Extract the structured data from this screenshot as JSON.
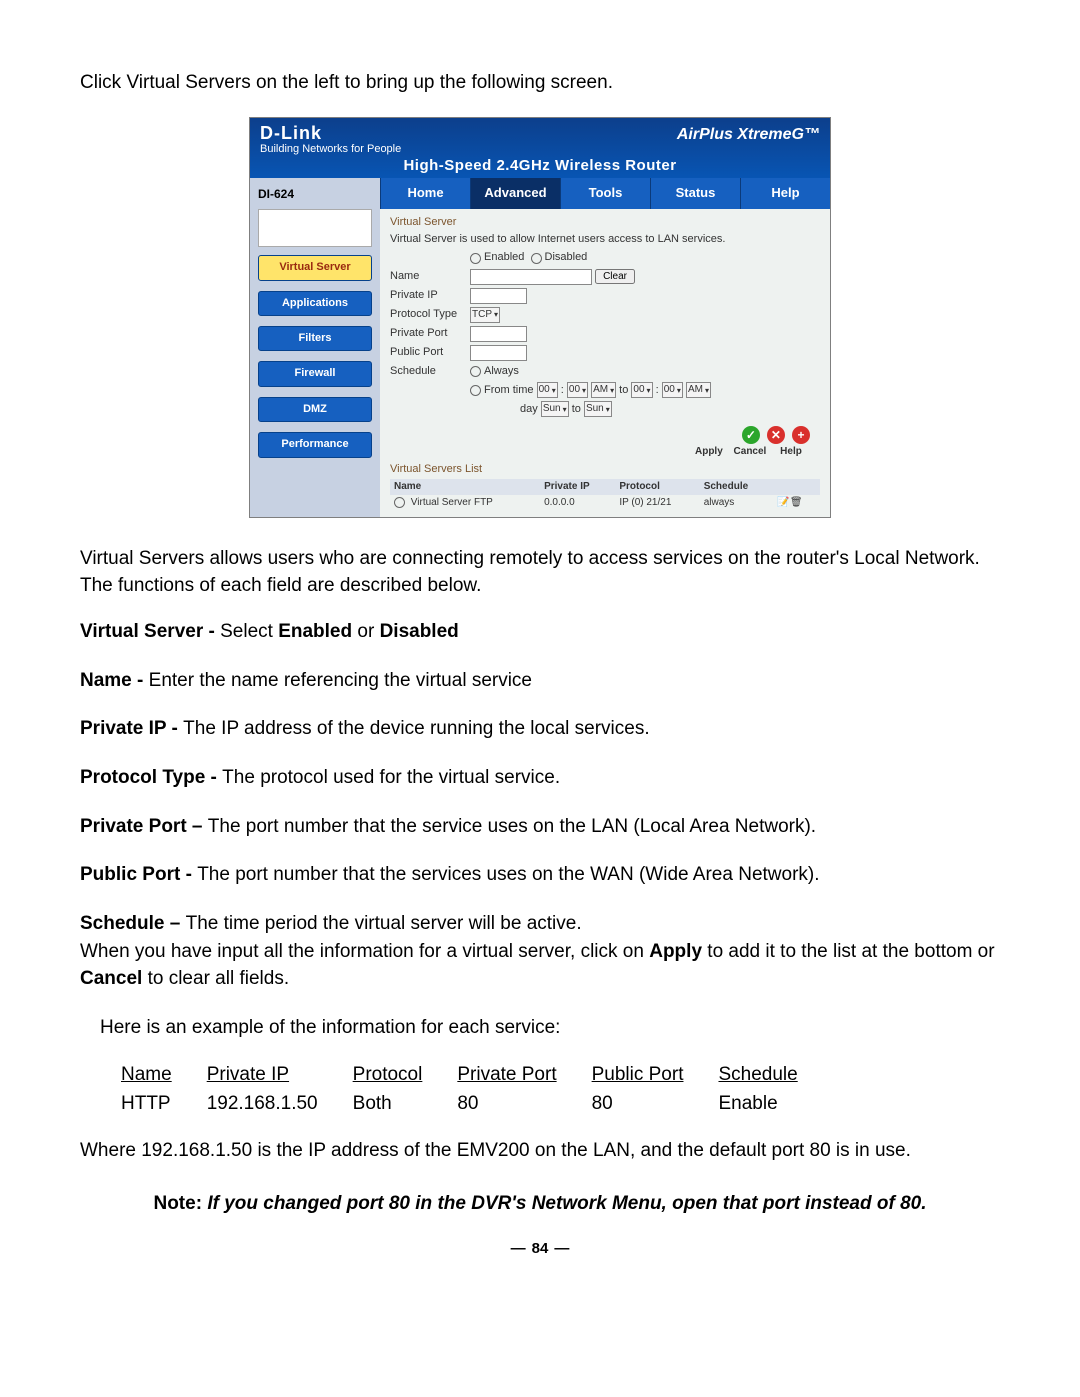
{
  "intro": "Click Virtual Servers on the left to bring up the following screen.",
  "router": {
    "brand_top": "D-Link",
    "brand_sub": "Building Networks for People",
    "logo": "AirPlus XtremeG™",
    "tagline": "High-Speed 2.4GHz Wireless Router",
    "model": "DI-624",
    "side": [
      "Virtual Server",
      "Applications",
      "Filters",
      "Firewall",
      "DMZ",
      "Performance"
    ],
    "tabs": [
      "Home",
      "Advanced",
      "Tools",
      "Status",
      "Help"
    ],
    "section": "Virtual Server",
    "desc": "Virtual Server is used to allow Internet users access to LAN services.",
    "radios": [
      "Enabled",
      "Disabled"
    ],
    "fields": {
      "name": "Name",
      "pip": "Private IP",
      "ptype": "Protocol Type",
      "pport": "Private Port",
      "pubport": "Public Port",
      "sched": "Schedule"
    },
    "clear": "Clear",
    "proto_sel": "TCP",
    "always": "Always",
    "from": "From",
    "time": "time",
    "to": "to",
    "day": "day",
    "hh": "00",
    "ampm": "AM",
    "dow": "Sun",
    "btn_labels": [
      "Apply",
      "Cancel",
      "Help"
    ],
    "list_title": "Virtual Servers List",
    "list_hdr": [
      "Name",
      "Private IP",
      "Protocol",
      "Schedule"
    ],
    "list_row": [
      "Virtual Server FTP",
      "0.0.0.0",
      "IP (0) 21/21",
      "always"
    ]
  },
  "para2": "Virtual Servers allows users who are connecting remotely to access services on the router's Local Network. The functions of each field are described below.",
  "def": {
    "vs_b": "Virtual Server - ",
    "vs_mid": "Select ",
    "vs_en": "Enabled",
    "vs_or": " or ",
    "vs_dis": "Disabled",
    "name_b": "Name - ",
    "name_t": "Enter the name referencing the virtual service",
    "pip_b": "Private IP - ",
    "pip_t": "The IP address of the device running the local services.",
    "pt_b": "Protocol Type - ",
    "pt_t": "The protocol used for the virtual service.",
    "pp_b": "Private Port – ",
    "pp_t": "The port number that the service uses on the LAN (Local Area Network).",
    "pub_b": "Public Port - ",
    "pub_t": "The port number that the services uses on the WAN (Wide Area Network).",
    "sch_b": "Schedule – ",
    "sch_t": "The time period the virtual server will be active.",
    "apply1": "When you have input all the information for a virtual server, click on ",
    "apply_b": "Apply",
    "apply2": " to add it to the list at the bottom or ",
    "cancel_b": "Cancel",
    "apply3": " to clear all fields."
  },
  "ex_intro": "Here is an example of the information for each service:",
  "ex_hdr": [
    "Name",
    "Private IP",
    "Protocol",
    "Private Port",
    "Public Port",
    "Schedule"
  ],
  "ex_row": [
    "HTTP",
    "192.168.1.50",
    "Both",
    "80",
    "80",
    "Enable"
  ],
  "where": "Where 192.168.1.50 is the IP address of the EMV200 on the LAN, and the default port 80 is in use.",
  "note_b": "Note: ",
  "note_i": "If you changed port 80 in the DVR's Network Menu, open that port instead of 80.",
  "page": "84"
}
